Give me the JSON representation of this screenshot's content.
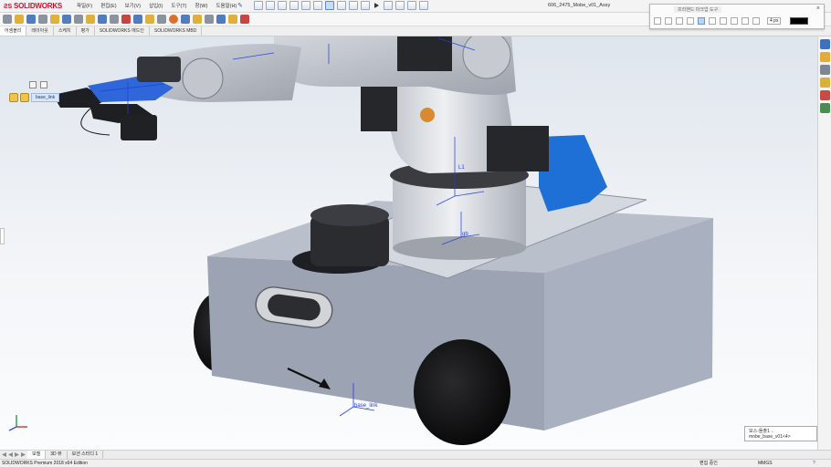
{
  "app": {
    "name": "SOLIDWORKS",
    "doc_title": "606_2475_Mobe_v01_Assy",
    "search_placeholder": ""
  },
  "menu": [
    "파일(F)",
    "편집(E)",
    "보기(V)",
    "삽입(I)",
    "도구(T)",
    "창(W)",
    "도움말(H)"
  ],
  "tabs": [
    "어셈블리",
    "레이아웃",
    "스케치",
    "평가",
    "SOLIDWORKS 애드인",
    "SOLIDWORKS MBD"
  ],
  "tree": {
    "node_label": "base_link"
  },
  "popup": {
    "title": "프리핸드 마크업 도구",
    "size": "4 px",
    "swatch_color": "#000000"
  },
  "viewport": {
    "triad_labels": [
      "X",
      "Y",
      "Z"
    ],
    "callout_labels": [
      "base_link",
      "gb",
      "L1"
    ],
    "view_tooltip": "보스-돌출1 ← mobe_base_v01<4>"
  },
  "model_tabs": [
    "모델",
    "3D 뷰",
    "모션 스터디 1"
  ],
  "status": {
    "left": "SOLIDWORKS Premium 2018 x64 Edition",
    "editing": "편집 중인",
    "units": "MMGS",
    "help": "?"
  },
  "colors": {
    "accent_red": "#c8102e",
    "selection_blue": "#1f3fd9",
    "robot_body": "#b8bcc4",
    "robot_blue_part": "#1e6fd6"
  }
}
